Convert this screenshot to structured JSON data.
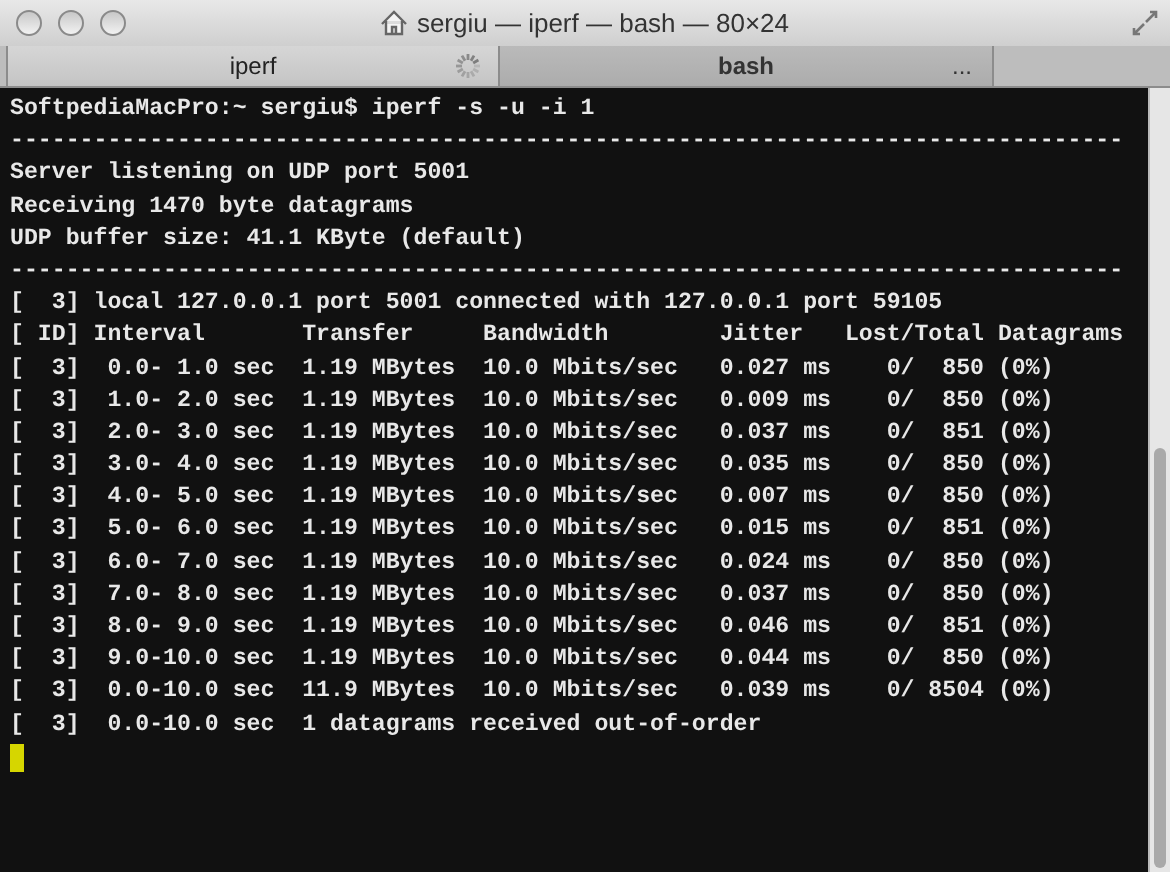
{
  "window": {
    "title": "sergiu — iperf — bash — 80×24"
  },
  "tabs": [
    {
      "label": "iperf",
      "selected": true,
      "busy": true
    },
    {
      "label": "bash",
      "selected": false,
      "busy": false,
      "more": "..."
    }
  ],
  "terminal": {
    "lines": [
      "SoftpediaMacPro:~ sergiu$ iperf -s -u -i 1",
      "--------------------------------------------------------------------------------",
      "Server listening on UDP port 5001",
      "Receiving 1470 byte datagrams",
      "UDP buffer size: 41.1 KByte (default)",
      "--------------------------------------------------------------------------------",
      "[  3] local 127.0.0.1 port 5001 connected with 127.0.0.1 port 59105",
      "[ ID] Interval       Transfer     Bandwidth        Jitter   Lost/Total Datagrams",
      "[  3]  0.0- 1.0 sec  1.19 MBytes  10.0 Mbits/sec   0.027 ms    0/  850 (0%)",
      "[  3]  1.0- 2.0 sec  1.19 MBytes  10.0 Mbits/sec   0.009 ms    0/  850 (0%)",
      "[  3]  2.0- 3.0 sec  1.19 MBytes  10.0 Mbits/sec   0.037 ms    0/  851 (0%)",
      "[  3]  3.0- 4.0 sec  1.19 MBytes  10.0 Mbits/sec   0.035 ms    0/  850 (0%)",
      "[  3]  4.0- 5.0 sec  1.19 MBytes  10.0 Mbits/sec   0.007 ms    0/  850 (0%)",
      "[  3]  5.0- 6.0 sec  1.19 MBytes  10.0 Mbits/sec   0.015 ms    0/  851 (0%)",
      "[  3]  6.0- 7.0 sec  1.19 MBytes  10.0 Mbits/sec   0.024 ms    0/  850 (0%)",
      "[  3]  7.0- 8.0 sec  1.19 MBytes  10.0 Mbits/sec   0.037 ms    0/  850 (0%)",
      "[  3]  8.0- 9.0 sec  1.19 MBytes  10.0 Mbits/sec   0.046 ms    0/  851 (0%)",
      "[  3]  9.0-10.0 sec  1.19 MBytes  10.0 Mbits/sec   0.044 ms    0/  850 (0%)",
      "[  3]  0.0-10.0 sec  11.9 MBytes  10.0 Mbits/sec   0.039 ms    0/ 8504 (0%)",
      "[  3]  0.0-10.0 sec  1 datagrams received out-of-order"
    ]
  }
}
